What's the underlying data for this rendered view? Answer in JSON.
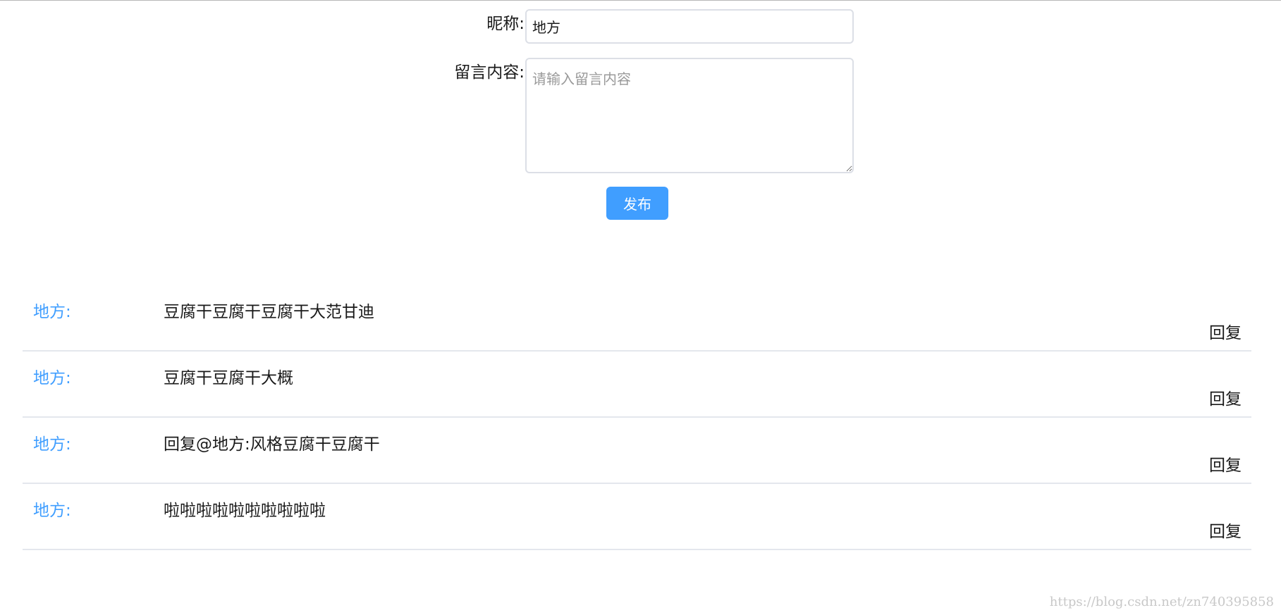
{
  "form": {
    "nickname_label": "昵称:",
    "nickname_value": "地方",
    "content_label": "留言内容:",
    "content_placeholder": "请输入留言内容",
    "submit_label": "发布"
  },
  "comments": [
    {
      "name": "地方:",
      "text": "豆腐干豆腐干豆腐干大范甘迪",
      "reply": "回复"
    },
    {
      "name": "地方:",
      "text": "豆腐干豆腐干大概",
      "reply": "回复"
    },
    {
      "name": "地方:",
      "text": "回复@地方:风格豆腐干豆腐干",
      "reply": "回复"
    },
    {
      "name": "地方:",
      "text": "啦啦啦啦啦啦啦啦啦啦",
      "reply": "回复"
    }
  ],
  "watermark": "https://blog.csdn.net/zn740395858",
  "colors": {
    "accent": "#409eff",
    "divider": "#e4e7ed",
    "input_border": "#dcdfe6"
  }
}
